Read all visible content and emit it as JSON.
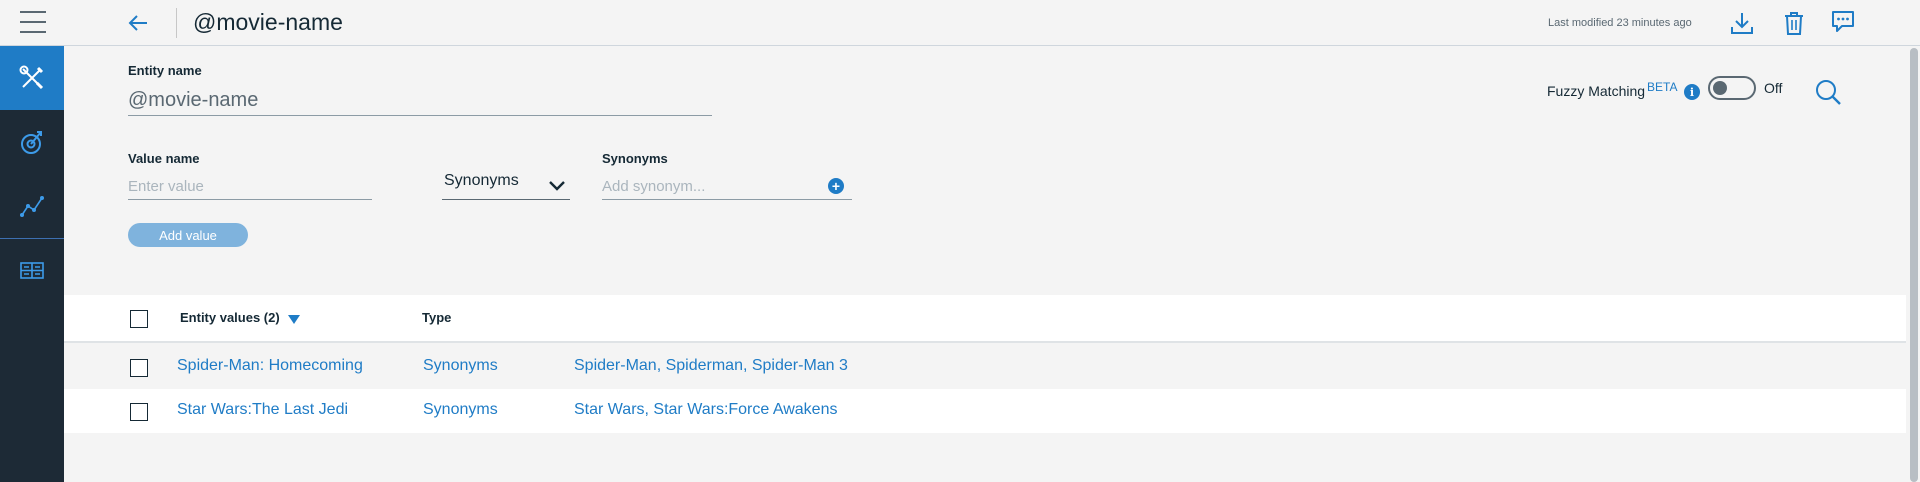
{
  "header": {
    "title": "@movie-name",
    "last_modified": "Last modified 23 minutes ago"
  },
  "icons": {
    "menu": "hamburger-menu-icon",
    "back": "arrow-left-icon",
    "download": "download-icon",
    "delete": "trash-icon",
    "chat": "chat-bubble-icon",
    "sidebar": [
      "tools-icon",
      "target-icon",
      "analytics-icon",
      "dashboard-icon"
    ],
    "search": "search-icon",
    "info": "info-icon",
    "add": "plus-circle-icon"
  },
  "colors": {
    "accent": "#1f7cc6",
    "sidebar_bg": "#1d2a36",
    "sidebar_active": "#1f7cc6",
    "add_button_bg": "#7fb3dd"
  },
  "entity": {
    "label": "Entity name",
    "value": "@movie-name"
  },
  "fuzzy": {
    "label": "Fuzzy Matching",
    "beta": "BETA",
    "info": "i",
    "state": "Off",
    "enabled": false
  },
  "form": {
    "value_name_label": "Value name",
    "value_placeholder": "Enter value",
    "type_selected": "Synonyms",
    "synonyms_label": "Synonyms",
    "synonyms_placeholder": "Add synonym...",
    "add_synonym_symbol": "+",
    "add_value_button": "Add value"
  },
  "table": {
    "columns": {
      "values": "Entity values (2)",
      "type": "Type"
    },
    "rows": [
      {
        "value": "Spider-Man: Homecoming",
        "type": "Synonyms",
        "synonyms": "Spider-Man, Spiderman, Spider-Man 3"
      },
      {
        "value": "Star Wars:The Last Jedi",
        "type": "Synonyms",
        "synonyms": "Star Wars, Star Wars:Force Awakens"
      }
    ]
  }
}
